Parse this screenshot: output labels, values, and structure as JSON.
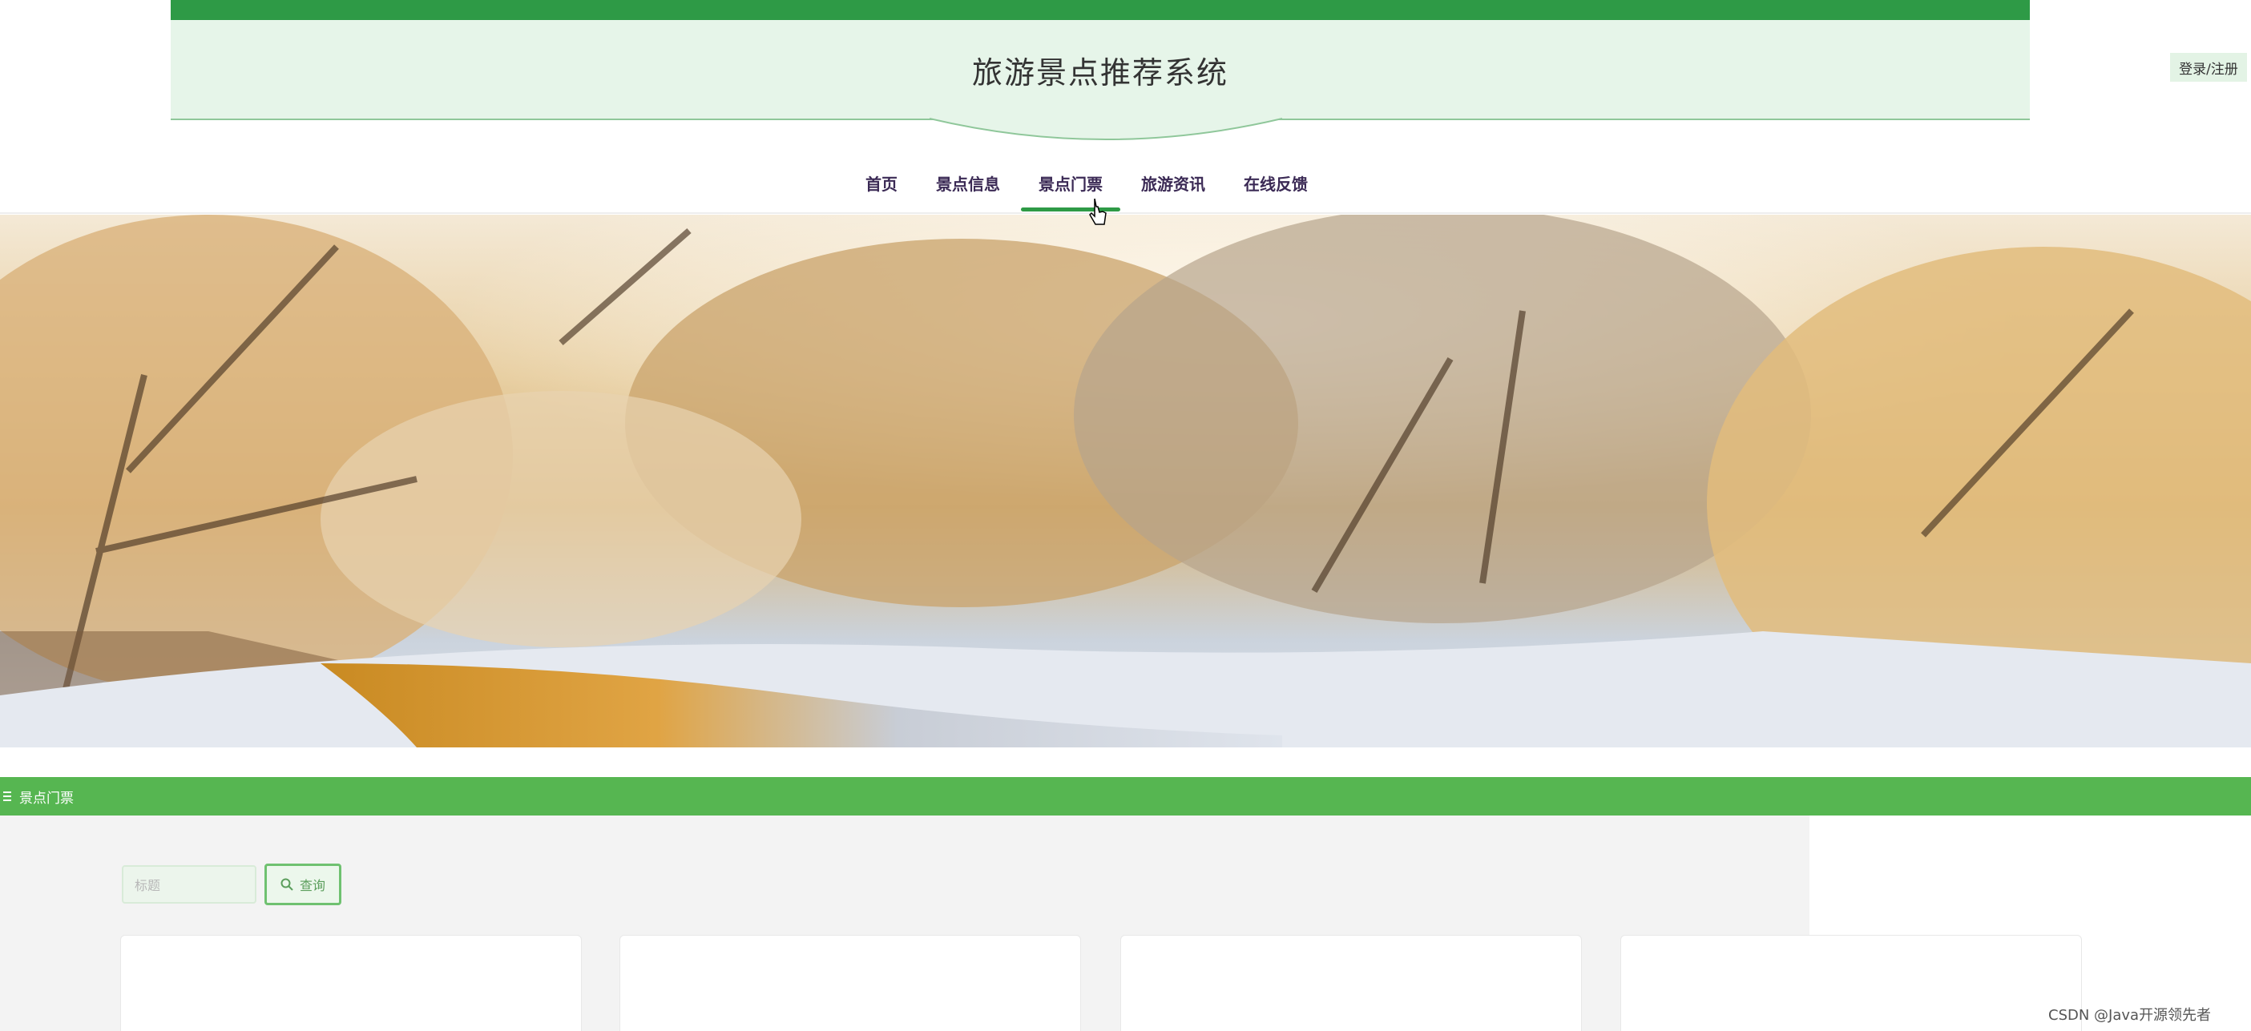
{
  "header": {
    "site_title": "旅游景点推荐系统",
    "login_label": "登录/注册"
  },
  "nav": {
    "items": [
      {
        "label": "首页"
      },
      {
        "label": "景点信息"
      },
      {
        "label": "景点门票"
      },
      {
        "label": "旅游资讯"
      },
      {
        "label": "在线反馈"
      }
    ],
    "active_index": 2
  },
  "section": {
    "title": "景点门票"
  },
  "search": {
    "placeholder": "标题",
    "button_label": "查询"
  },
  "watermark": "CSDN @Java开源领先者",
  "colors": {
    "primary": "#2e9a46",
    "section_bar": "#56b651",
    "header_band": "#e6f5e9"
  }
}
